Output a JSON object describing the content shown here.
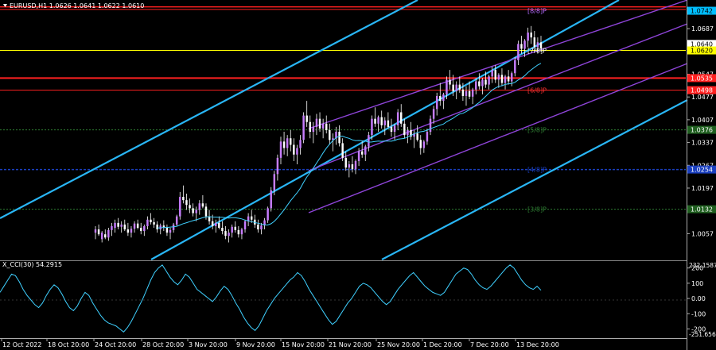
{
  "chart_data": {
    "type": "candlestick",
    "title": "EURUSD,H1 1.0626 1.0641 1.0622 1.0610",
    "symbol": "EURUSD",
    "timeframe": "H1",
    "ohlc_header": [
      "1.0626",
      "1.0641",
      "1.0622",
      "1.0610"
    ],
    "price_range": [
      0.9975,
      1.0775
    ],
    "price_ticks": [
      "1.0757",
      "1.0687",
      "1.0617",
      "1.0547",
      "1.0477",
      "1.0407",
      "1.0337",
      "1.0267",
      "1.0197",
      "1.0127",
      "1.0057"
    ],
    "price_ticks_display": [
      "1.0687",
      "1.0640",
      "1.0547",
      "1.0477",
      "1.0407",
      "1.0337",
      "1.0267",
      "1.0197",
      "1.0057"
    ],
    "highlight_tags": [
      {
        "price": 1.0742,
        "text": "1.0742",
        "bg": "#00bfff",
        "fg": "#000000"
      },
      {
        "price": 1.064,
        "text": "1.0640",
        "bg": "#ffffff",
        "fg": "#000000"
      },
      {
        "price": 1.062,
        "text": "1.0620",
        "bg": "#ffff00",
        "fg": "#000000"
      },
      {
        "price": 1.0535,
        "text": "1.0535",
        "bg": "#ff2020",
        "fg": "#ffffff"
      },
      {
        "price": 1.0498,
        "text": "1.0498",
        "bg": "#ff2020",
        "fg": "#ffffff"
      },
      {
        "price": 1.0376,
        "text": "1.0376",
        "bg": "#1f5f1f",
        "fg": "#ffffff"
      },
      {
        "price": 1.0254,
        "text": "1.0254",
        "bg": "#1a3fbf",
        "fg": "#ffffff"
      },
      {
        "price": 1.0132,
        "text": "1.0132",
        "bg": "#1f5f1f",
        "fg": "#ffffff"
      }
    ],
    "horizontal_levels": [
      {
        "price": 1.0754,
        "color": "#ff2020",
        "width": 1.5
      },
      {
        "price": 1.0746,
        "color": "#ff2020",
        "width": 1
      },
      {
        "price": 1.062,
        "color": "#ffff00",
        "width": 1
      },
      {
        "price": 1.0535,
        "color": "#ff2020",
        "width": 2
      },
      {
        "price": 1.0498,
        "color": "#ff2020",
        "width": 1
      },
      {
        "price": 1.0376,
        "color": "#2e7d32",
        "width": 1,
        "dash": "2,2"
      },
      {
        "price": 1.0254,
        "color": "#1a3fbf",
        "width": 1.5,
        "dash": "3,2"
      },
      {
        "price": 1.0132,
        "color": "#2e7d32",
        "width": 1,
        "dash": "2,2"
      }
    ],
    "murrey_labels": [
      {
        "text": "[8/8]P",
        "price": 1.0742,
        "color": "#b36bff"
      },
      {
        "text": "[7/8]P",
        "price": 1.062,
        "color": "#ffffff"
      },
      {
        "text": "[6/8]P",
        "price": 1.0498,
        "color": "#ff3030"
      },
      {
        "text": "[5/8]P",
        "price": 1.0376,
        "color": "#2e7d32"
      },
      {
        "text": "[4/8]P",
        "price": 1.0254,
        "color": "#1a3fbf"
      },
      {
        "text": "[3/8]P",
        "price": 1.0132,
        "color": "#2e7d32"
      }
    ],
    "x_ticks": [
      "12 Oct 2022",
      "18 Oct 20:00",
      "24 Oct 20:00",
      "28 Oct 20:00",
      "3 Nov 20:00",
      "9 Nov 20:00",
      "15 Nov 20:00",
      "21 Nov 20:00",
      "25 Nov 20:00",
      "1 Dec 20:00",
      "7 Dec 20:00",
      "13 Dec 20:00"
    ],
    "candles": [
      {
        "o": 1.006,
        "h": 1.008,
        "l": 1.004,
        "c": 1.007
      },
      {
        "o": 1.007,
        "h": 1.0085,
        "l": 1.005,
        "c": 1.0055
      },
      {
        "o": 1.004,
        "h": 1.0065,
        "l": 1.003,
        "c": 1.006
      },
      {
        "o": 1.0055,
        "h": 1.007,
        "l": 1.004,
        "c": 1.0045
      },
      {
        "o": 1.0045,
        "h": 1.0075,
        "l": 1.0035,
        "c": 1.0068
      },
      {
        "o": 1.0068,
        "h": 1.009,
        "l": 1.005,
        "c": 1.008
      },
      {
        "o": 1.0075,
        "h": 1.01,
        "l": 1.006,
        "c": 1.009
      },
      {
        "o": 1.009,
        "h": 1.0105,
        "l": 1.007,
        "c": 1.0078
      },
      {
        "o": 1.0078,
        "h": 1.0095,
        "l": 1.006,
        "c": 1.0085
      },
      {
        "o": 1.0085,
        "h": 1.01,
        "l": 1.0065,
        "c": 1.007
      },
      {
        "o": 1.007,
        "h": 1.009,
        "l": 1.005,
        "c": 1.006
      },
      {
        "o": 1.006,
        "h": 1.008,
        "l": 1.0045,
        "c": 1.0072
      },
      {
        "o": 1.0072,
        "h": 1.0095,
        "l": 1.006,
        "c": 1.0088
      },
      {
        "o": 1.0088,
        "h": 1.01,
        "l": 1.007,
        "c": 1.0075
      },
      {
        "o": 1.0075,
        "h": 1.009,
        "l": 1.0055,
        "c": 1.0065
      },
      {
        "o": 1.0065,
        "h": 1.0085,
        "l": 1.005,
        "c": 1.008
      },
      {
        "o": 1.008,
        "h": 1.011,
        "l": 1.007,
        "c": 1.01
      },
      {
        "o": 1.01,
        "h": 1.012,
        "l": 1.0085,
        "c": 1.0092
      },
      {
        "o": 1.0092,
        "h": 1.0105,
        "l": 1.0075,
        "c": 1.0085
      },
      {
        "o": 1.0085,
        "h": 1.0095,
        "l": 1.006,
        "c": 1.007
      },
      {
        "o": 1.007,
        "h": 1.0088,
        "l": 1.0055,
        "c": 1.0082
      },
      {
        "o": 1.0082,
        "h": 1.0098,
        "l": 1.0065,
        "c": 1.0075
      },
      {
        "o": 1.0075,
        "h": 1.0085,
        "l": 1.005,
        "c": 1.006
      },
      {
        "o": 1.006,
        "h": 1.0075,
        "l": 1.004,
        "c": 1.0068
      },
      {
        "o": 1.0068,
        "h": 1.009,
        "l": 1.006,
        "c": 1.0085
      },
      {
        "o": 1.0085,
        "h": 1.0115,
        "l": 1.008,
        "c": 1.011
      },
      {
        "o": 1.011,
        "h": 1.0185,
        "l": 1.01,
        "c": 1.017
      },
      {
        "o": 1.017,
        "h": 1.0205,
        "l": 1.015,
        "c": 1.016
      },
      {
        "o": 1.016,
        "h": 1.018,
        "l": 1.013,
        "c": 1.0145
      },
      {
        "o": 1.0145,
        "h": 1.0165,
        "l": 1.012,
        "c": 1.0135
      },
      {
        "o": 1.0135,
        "h": 1.015,
        "l": 1.011,
        "c": 1.012
      },
      {
        "o": 1.012,
        "h": 1.014,
        "l": 1.0095,
        "c": 1.013
      },
      {
        "o": 1.013,
        "h": 1.016,
        "l": 1.0115,
        "c": 1.015
      },
      {
        "o": 1.015,
        "h": 1.0175,
        "l": 1.0135,
        "c": 1.014
      },
      {
        "o": 1.014,
        "h": 1.015,
        "l": 1.01,
        "c": 1.011
      },
      {
        "o": 1.011,
        "h": 1.013,
        "l": 1.0085,
        "c": 1.0095
      },
      {
        "o": 1.0095,
        "h": 1.0115,
        "l": 1.007,
        "c": 1.008
      },
      {
        "o": 1.008,
        "h": 1.01,
        "l": 1.006,
        "c": 1.009
      },
      {
        "o": 1.009,
        "h": 1.011,
        "l": 1.007,
        "c": 1.0075
      },
      {
        "o": 1.0075,
        "h": 1.0095,
        "l": 1.0055,
        "c": 1.0065
      },
      {
        "o": 1.0065,
        "h": 1.008,
        "l": 1.004,
        "c": 1.005
      },
      {
        "o": 1.005,
        "h": 1.007,
        "l": 1.003,
        "c": 1.006
      },
      {
        "o": 1.006,
        "h": 1.0085,
        "l": 1.0045,
        "c": 1.0078
      },
      {
        "o": 1.0078,
        "h": 1.0095,
        "l": 1.006,
        "c": 1.0068
      },
      {
        "o": 1.0068,
        "h": 1.008,
        "l": 1.0045,
        "c": 1.0055
      },
      {
        "o": 1.0055,
        "h": 1.0075,
        "l": 1.004,
        "c": 1.007
      },
      {
        "o": 1.007,
        "h": 1.01,
        "l": 1.006,
        "c": 1.0095
      },
      {
        "o": 1.0095,
        "h": 1.012,
        "l": 1.008,
        "c": 1.011
      },
      {
        "o": 1.011,
        "h": 1.013,
        "l": 1.009,
        "c": 1.01
      },
      {
        "o": 1.01,
        "h": 1.0115,
        "l": 1.0075,
        "c": 1.0085
      },
      {
        "o": 1.0085,
        "h": 1.01,
        "l": 1.006,
        "c": 1.007
      },
      {
        "o": 1.007,
        "h": 1.009,
        "l": 1.0055,
        "c": 1.0082
      },
      {
        "o": 1.0082,
        "h": 1.0105,
        "l": 1.007,
        "c": 1.0098
      },
      {
        "o": 1.0098,
        "h": 1.014,
        "l": 1.009,
        "c": 1.0135
      },
      {
        "o": 1.0135,
        "h": 1.02,
        "l": 1.0125,
        "c": 1.019
      },
      {
        "o": 1.019,
        "h": 1.025,
        "l": 1.0175,
        "c": 1.024
      },
      {
        "o": 1.024,
        "h": 1.03,
        "l": 1.022,
        "c": 1.029
      },
      {
        "o": 1.029,
        "h": 1.0355,
        "l": 1.027,
        "c": 1.034
      },
      {
        "o": 1.034,
        "h": 1.037,
        "l": 1.03,
        "c": 1.032
      },
      {
        "o": 1.032,
        "h": 1.036,
        "l": 1.0295,
        "c": 1.035
      },
      {
        "o": 1.035,
        "h": 1.0375,
        "l": 1.031,
        "c": 1.033
      },
      {
        "o": 1.033,
        "h": 1.035,
        "l": 1.028,
        "c": 1.03
      },
      {
        "o": 1.03,
        "h": 1.033,
        "l": 1.027,
        "c": 1.032
      },
      {
        "o": 1.032,
        "h": 1.036,
        "l": 1.03,
        "c": 1.0345
      },
      {
        "o": 1.0345,
        "h": 1.043,
        "l": 1.0335,
        "c": 1.042
      },
      {
        "o": 1.042,
        "h": 1.0465,
        "l": 1.0385,
        "c": 1.04
      },
      {
        "o": 1.04,
        "h": 1.042,
        "l": 1.035,
        "c": 1.037
      },
      {
        "o": 1.037,
        "h": 1.04,
        "l": 1.0335,
        "c": 1.0385
      },
      {
        "o": 1.0385,
        "h": 1.0425,
        "l": 1.036,
        "c": 1.041
      },
      {
        "o": 1.041,
        "h": 1.043,
        "l": 1.037,
        "c": 1.038
      },
      {
        "o": 1.038,
        "h": 1.041,
        "l": 1.035,
        "c": 1.0395
      },
      {
        "o": 1.0395,
        "h": 1.042,
        "l": 1.0365,
        "c": 1.0375
      },
      {
        "o": 1.0375,
        "h": 1.0395,
        "l": 1.033,
        "c": 1.0345
      },
      {
        "o": 1.0345,
        "h": 1.0365,
        "l": 1.031,
        "c": 1.035
      },
      {
        "o": 1.035,
        "h": 1.0385,
        "l": 1.033,
        "c": 1.037
      },
      {
        "o": 1.037,
        "h": 1.039,
        "l": 1.0325,
        "c": 1.0335
      },
      {
        "o": 1.0335,
        "h": 1.035,
        "l": 1.028,
        "c": 1.029
      },
      {
        "o": 1.029,
        "h": 1.031,
        "l": 1.025,
        "c": 1.026
      },
      {
        "o": 1.026,
        "h": 1.028,
        "l": 1.023,
        "c": 1.027
      },
      {
        "o": 1.027,
        "h": 1.0295,
        "l": 1.0245,
        "c": 1.0255
      },
      {
        "o": 1.0255,
        "h": 1.0285,
        "l": 1.024,
        "c": 1.028
      },
      {
        "o": 1.028,
        "h": 1.032,
        "l": 1.0265,
        "c": 1.031
      },
      {
        "o": 1.031,
        "h": 1.034,
        "l": 1.029,
        "c": 1.03
      },
      {
        "o": 1.03,
        "h": 1.033,
        "l": 1.028,
        "c": 1.0325
      },
      {
        "o": 1.0325,
        "h": 1.037,
        "l": 1.031,
        "c": 1.036
      },
      {
        "o": 1.036,
        "h": 1.042,
        "l": 1.0345,
        "c": 1.041
      },
      {
        "o": 1.041,
        "h": 1.0445,
        "l": 1.0385,
        "c": 1.0395
      },
      {
        "o": 1.0395,
        "h": 1.042,
        "l": 1.037,
        "c": 1.0415
      },
      {
        "o": 1.0415,
        "h": 1.0435,
        "l": 1.038,
        "c": 1.039
      },
      {
        "o": 1.039,
        "h": 1.0415,
        "l": 1.036,
        "c": 1.0405
      },
      {
        "o": 1.0405,
        "h": 1.043,
        "l": 1.038,
        "c": 1.0385
      },
      {
        "o": 1.0385,
        "h": 1.041,
        "l": 1.0355,
        "c": 1.037
      },
      {
        "o": 1.037,
        "h": 1.0395,
        "l": 1.0345,
        "c": 1.039
      },
      {
        "o": 1.039,
        "h": 1.044,
        "l": 1.0375,
        "c": 1.043
      },
      {
        "o": 1.043,
        "h": 1.0455,
        "l": 1.0385,
        "c": 1.0395
      },
      {
        "o": 1.0395,
        "h": 1.041,
        "l": 1.035,
        "c": 1.036
      },
      {
        "o": 1.036,
        "h": 1.0385,
        "l": 1.0335,
        "c": 1.0375
      },
      {
        "o": 1.0375,
        "h": 1.04,
        "l": 1.0345,
        "c": 1.0355
      },
      {
        "o": 1.0355,
        "h": 1.0375,
        "l": 1.032,
        "c": 1.0365
      },
      {
        "o": 1.0365,
        "h": 1.039,
        "l": 1.034,
        "c": 1.0345
      },
      {
        "o": 1.0345,
        "h": 1.036,
        "l": 1.03,
        "c": 1.032
      },
      {
        "o": 1.032,
        "h": 1.0345,
        "l": 1.0305,
        "c": 1.034
      },
      {
        "o": 1.034,
        "h": 1.038,
        "l": 1.033,
        "c": 1.037
      },
      {
        "o": 1.037,
        "h": 1.042,
        "l": 1.036,
        "c": 1.041
      },
      {
        "o": 1.041,
        "h": 1.045,
        "l": 1.0395,
        "c": 1.044
      },
      {
        "o": 1.044,
        "h": 1.049,
        "l": 1.042,
        "c": 1.048
      },
      {
        "o": 1.048,
        "h": 1.052,
        "l": 1.045,
        "c": 1.0465
      },
      {
        "o": 1.0465,
        "h": 1.049,
        "l": 1.044,
        "c": 1.0485
      },
      {
        "o": 1.0485,
        "h": 1.054,
        "l": 1.047,
        "c": 1.053
      },
      {
        "o": 1.053,
        "h": 1.056,
        "l": 1.05,
        "c": 1.0515
      },
      {
        "o": 1.0515,
        "h": 1.0545,
        "l": 1.048,
        "c": 1.0495
      },
      {
        "o": 1.0495,
        "h": 1.0525,
        "l": 1.047,
        "c": 1.0515
      },
      {
        "o": 1.0515,
        "h": 1.054,
        "l": 1.049,
        "c": 1.05
      },
      {
        "o": 1.05,
        "h": 1.052,
        "l": 1.0465,
        "c": 1.048
      },
      {
        "o": 1.048,
        "h": 1.051,
        "l": 1.045,
        "c": 1.0495
      },
      {
        "o": 1.0495,
        "h": 1.0525,
        "l": 1.047,
        "c": 1.0478
      },
      {
        "o": 1.0478,
        "h": 1.0505,
        "l": 1.0455,
        "c": 1.05
      },
      {
        "o": 1.05,
        "h": 1.0535,
        "l": 1.0485,
        "c": 1.0525
      },
      {
        "o": 1.0525,
        "h": 1.055,
        "l": 1.05,
        "c": 1.051
      },
      {
        "o": 1.051,
        "h": 1.0535,
        "l": 1.0485,
        "c": 1.053
      },
      {
        "o": 1.053,
        "h": 1.0555,
        "l": 1.0505,
        "c": 1.0515
      },
      {
        "o": 1.0515,
        "h": 1.0545,
        "l": 1.05,
        "c": 1.054
      },
      {
        "o": 1.054,
        "h": 1.057,
        "l": 1.052,
        "c": 1.056
      },
      {
        "o": 1.056,
        "h": 1.0575,
        "l": 1.052,
        "c": 1.053
      },
      {
        "o": 1.053,
        "h": 1.055,
        "l": 1.0505,
        "c": 1.0545
      },
      {
        "o": 1.0545,
        "h": 1.0565,
        "l": 1.051,
        "c": 1.052
      },
      {
        "o": 1.052,
        "h": 1.0545,
        "l": 1.05,
        "c": 1.054
      },
      {
        "o": 1.054,
        "h": 1.056,
        "l": 1.0515,
        "c": 1.0525
      },
      {
        "o": 1.0525,
        "h": 1.0555,
        "l": 1.051,
        "c": 1.055
      },
      {
        "o": 1.055,
        "h": 1.06,
        "l": 1.054,
        "c": 1.059
      },
      {
        "o": 1.059,
        "h": 1.065,
        "l": 1.0575,
        "c": 1.064
      },
      {
        "o": 1.064,
        "h": 1.0665,
        "l": 1.061,
        "c": 1.0625
      },
      {
        "o": 1.0625,
        "h": 1.0655,
        "l": 1.06,
        "c": 1.065
      },
      {
        "o": 1.065,
        "h": 1.069,
        "l": 1.063,
        "c": 1.0675
      },
      {
        "o": 1.0675,
        "h": 1.0695,
        "l": 1.064,
        "c": 1.066
      },
      {
        "o": 1.066,
        "h": 1.068,
        "l": 1.0615,
        "c": 1.063
      },
      {
        "o": 1.063,
        "h": 1.066,
        "l": 1.061,
        "c": 1.0645
      },
      {
        "o": 1.0645,
        "h": 1.0665,
        "l": 1.0615,
        "c": 1.0626
      }
    ],
    "ma_color": "#3fd0ff",
    "indicator": {
      "name": "X_CCI(30) 54.2915",
      "top_label": "232.1587",
      "bottom_label": "-251.6565",
      "range": [
        -260,
        240
      ],
      "ticks": [
        "200",
        "100",
        "0.00",
        "-100",
        "-200"
      ],
      "tick_values": [
        200,
        100,
        0,
        -100,
        -200
      ],
      "line_color": "#3fd0ff",
      "values": [
        40,
        80,
        120,
        160,
        150,
        110,
        60,
        20,
        -10,
        -40,
        -60,
        -30,
        20,
        60,
        90,
        70,
        30,
        -20,
        -60,
        -80,
        -50,
        0,
        40,
        20,
        -30,
        -70,
        -110,
        -140,
        -160,
        -170,
        -180,
        -200,
        -220,
        -190,
        -150,
        -100,
        -50,
        0,
        60,
        120,
        170,
        200,
        220,
        180,
        140,
        110,
        90,
        120,
        160,
        140,
        100,
        60,
        40,
        20,
        0,
        -20,
        10,
        50,
        80,
        60,
        20,
        -30,
        -70,
        -120,
        -160,
        -190,
        -210,
        -180,
        -130,
        -80,
        -40,
        0,
        30,
        60,
        90,
        120,
        140,
        170,
        150,
        110,
        60,
        20,
        -20,
        -60,
        -100,
        -140,
        -170,
        -150,
        -110,
        -70,
        -30,
        0,
        40,
        80,
        100,
        90,
        70,
        40,
        10,
        -20,
        -40,
        -20,
        20,
        60,
        90,
        120,
        150,
        170,
        140,
        110,
        80,
        60,
        40,
        30,
        20,
        40,
        80,
        120,
        160,
        180,
        200,
        190,
        160,
        120,
        90,
        70,
        60,
        80,
        110,
        140,
        170,
        200,
        220,
        200,
        160,
        120,
        90,
        70,
        60,
        80,
        54
      ]
    }
  }
}
